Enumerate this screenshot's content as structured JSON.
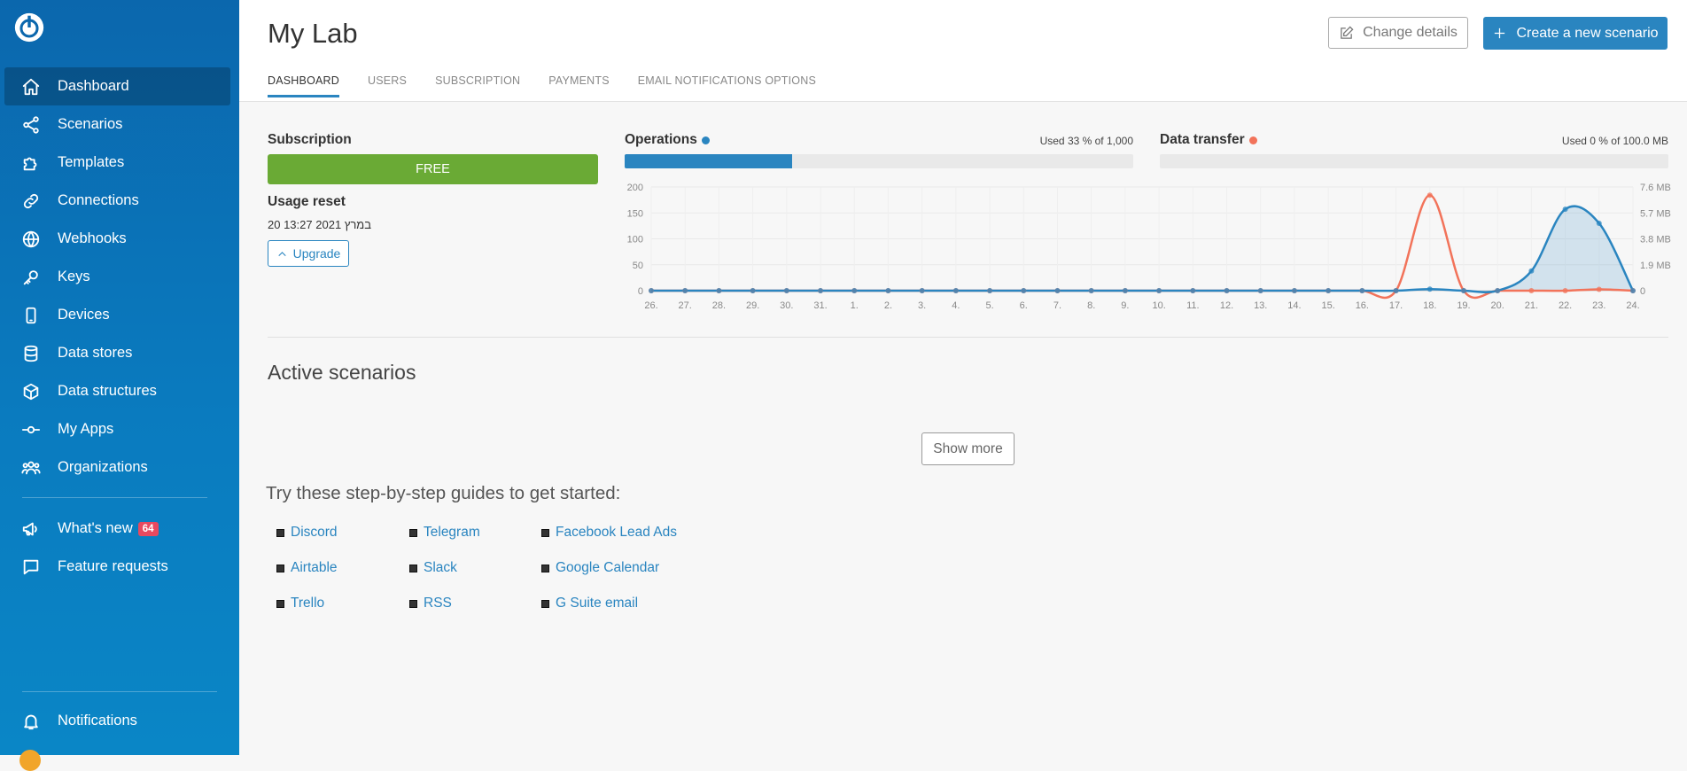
{
  "sidebar": {
    "items": [
      {
        "label": "Dashboard",
        "icon": "home-icon"
      },
      {
        "label": "Scenarios",
        "icon": "share-icon"
      },
      {
        "label": "Templates",
        "icon": "puzzle-icon"
      },
      {
        "label": "Connections",
        "icon": "link-icon"
      },
      {
        "label": "Webhooks",
        "icon": "globe-icon"
      },
      {
        "label": "Keys",
        "icon": "key-icon"
      },
      {
        "label": "Devices",
        "icon": "mobile-icon"
      },
      {
        "label": "Data stores",
        "icon": "database-icon"
      },
      {
        "label": "Data structures",
        "icon": "cube-icon"
      },
      {
        "label": "My Apps",
        "icon": "commit-icon"
      },
      {
        "label": "Organizations",
        "icon": "users-icon"
      }
    ],
    "whats_new": {
      "label": "What's new",
      "badge": "64"
    },
    "feature_requests": "Feature requests",
    "notifications": "Notifications"
  },
  "header": {
    "title": "My Lab",
    "tabs": [
      "DASHBOARD",
      "USERS",
      "SUBSCRIPTION",
      "PAYMENTS",
      "EMAIL NOTIFICATIONS OPTIONS"
    ],
    "change_details": "Change details",
    "create_scenario": "Create a new scenario"
  },
  "subscription": {
    "label": "Subscription",
    "plan": "FREE",
    "reset_label": "Usage reset",
    "reset_date": "20 במרץ 2021 13:27",
    "upgrade": "Upgrade"
  },
  "operations": {
    "label": "Operations",
    "used_text": "Used 33 % of 1,000",
    "fraction": 0.33
  },
  "data_transfer": {
    "label": "Data transfer",
    "used_text": "Used 0 % of 100.0 MB",
    "fraction": 0.0
  },
  "colors": {
    "ops": "#2a85c0",
    "dt": "#f2735a",
    "green": "#6aaa35"
  },
  "chart_data": {
    "type": "line",
    "x": [
      "26.",
      "27.",
      "28.",
      "29.",
      "30.",
      "31.",
      "1.",
      "2.",
      "3.",
      "4.",
      "5.",
      "6.",
      "7.",
      "8.",
      "9.",
      "10.",
      "11.",
      "12.",
      "13.",
      "14.",
      "15.",
      "16.",
      "17.",
      "18.",
      "19.",
      "20.",
      "21.",
      "22.",
      "23.",
      "24."
    ],
    "y_ticks_left": [
      "200",
      "150",
      "100",
      "50",
      "0"
    ],
    "y_ticks_right": [
      "7.6 MB",
      "5.7 MB",
      "3.8 MB",
      "1.9 MB",
      "0"
    ],
    "ylim": [
      0,
      200
    ],
    "y2lim": [
      0,
      7.6
    ],
    "grid": true,
    "series": [
      {
        "name": "Operations",
        "axis": "left",
        "values": [
          0,
          0,
          0,
          0,
          0,
          0,
          0,
          0,
          0,
          0,
          0,
          0,
          0,
          0,
          0,
          0,
          0,
          0,
          0,
          0,
          0,
          0,
          0,
          3,
          0,
          0,
          38,
          157,
          130,
          0
        ]
      },
      {
        "name": "Data transfer",
        "axis": "right",
        "values": [
          0,
          0,
          0,
          0,
          0,
          0,
          0,
          0,
          0,
          0,
          0,
          0,
          0,
          0,
          0,
          0,
          0,
          0,
          0,
          0,
          0,
          0,
          0,
          7.0,
          0,
          0,
          0,
          0,
          0.1,
          0
        ]
      }
    ]
  },
  "active_scenarios": {
    "title": "Active scenarios",
    "show_more": "Show more"
  },
  "guides": {
    "title": "Try these step-by-step guides to get started:",
    "items": [
      [
        "Discord",
        "Telegram",
        "Facebook Lead Ads"
      ],
      [
        "Airtable",
        "Slack",
        "Google Calendar"
      ],
      [
        "Trello",
        "RSS",
        "G Suite email"
      ]
    ]
  }
}
